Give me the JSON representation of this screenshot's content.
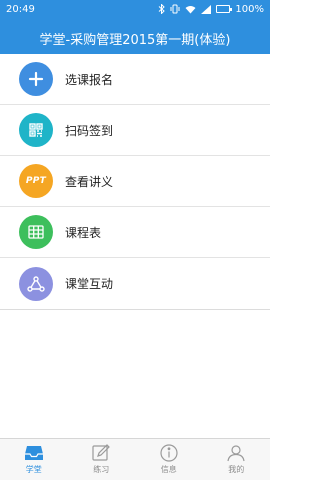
{
  "status_bar": {
    "time": "20:49",
    "battery_text": "100%",
    "icons": [
      "bluetooth-icon",
      "vibrate-icon",
      "wifi-icon",
      "signal-icon",
      "battery-icon"
    ]
  },
  "header": {
    "title": "学堂-采购管理2015第一期(体验)"
  },
  "menu": {
    "items": [
      {
        "label": "选课报名",
        "icon": "plus-icon",
        "color": "#3f8ee0"
      },
      {
        "label": "扫码签到",
        "icon": "qr-code-icon",
        "color": "#1fb4c8"
      },
      {
        "label": "查看讲义",
        "icon": "ppt-icon",
        "icon_text": "PPT",
        "color": "#f5a623"
      },
      {
        "label": "课程表",
        "icon": "table-icon",
        "color": "#3dbf5c"
      },
      {
        "label": "课堂互动",
        "icon": "share-network-icon",
        "color": "#8c91e0"
      }
    ]
  },
  "tab_bar": {
    "tabs": [
      {
        "label": "学堂",
        "icon": "inbox-tray-icon",
        "active": true
      },
      {
        "label": "练习",
        "icon": "edit-icon",
        "active": false
      },
      {
        "label": "信息",
        "icon": "info-icon",
        "active": false
      },
      {
        "label": "我的",
        "icon": "user-icon",
        "active": false
      }
    ],
    "active_color": "#2e8fde",
    "inactive_color": "#8c8c8c"
  }
}
